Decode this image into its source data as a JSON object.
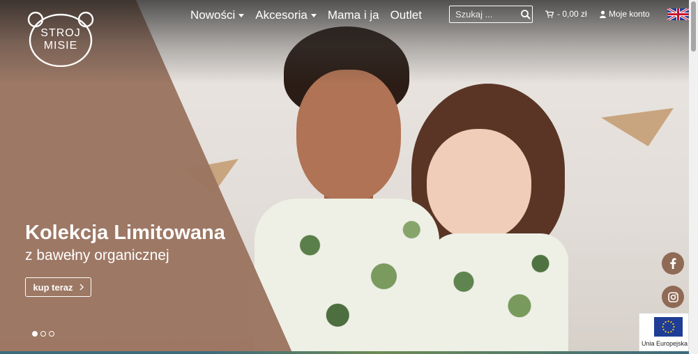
{
  "brand": {
    "logo_line1": "STROJ",
    "logo_line2": "MISIE"
  },
  "nav": {
    "items": [
      {
        "label": "Nowości",
        "dropdown": true
      },
      {
        "label": "Akcesoria",
        "dropdown": true
      },
      {
        "label": "Mama i ja",
        "dropdown": false
      },
      {
        "label": "Outlet",
        "dropdown": false
      }
    ]
  },
  "search": {
    "placeholder": "Szukaj ...",
    "icon": "search-icon"
  },
  "cart": {
    "label": "- 0,00 zł",
    "icon": "cart-icon"
  },
  "account": {
    "label": "Moje konto",
    "icon": "user-icon"
  },
  "language": {
    "icon": "uk-flag-icon"
  },
  "hero": {
    "title": "Kolekcja Limitowana",
    "subtitle": "z bawełny organicznej",
    "cta_label": "kup teraz",
    "slides": 3,
    "active_slide": 1
  },
  "social": {
    "facebook_icon": "facebook-icon",
    "instagram_icon": "instagram-icon"
  },
  "eu_badge": {
    "label": "Unia Europejska"
  },
  "colors": {
    "brand_brown": "#9a7460",
    "social_brown": "#8f6a55",
    "eu_blue": "#1f3d96"
  }
}
